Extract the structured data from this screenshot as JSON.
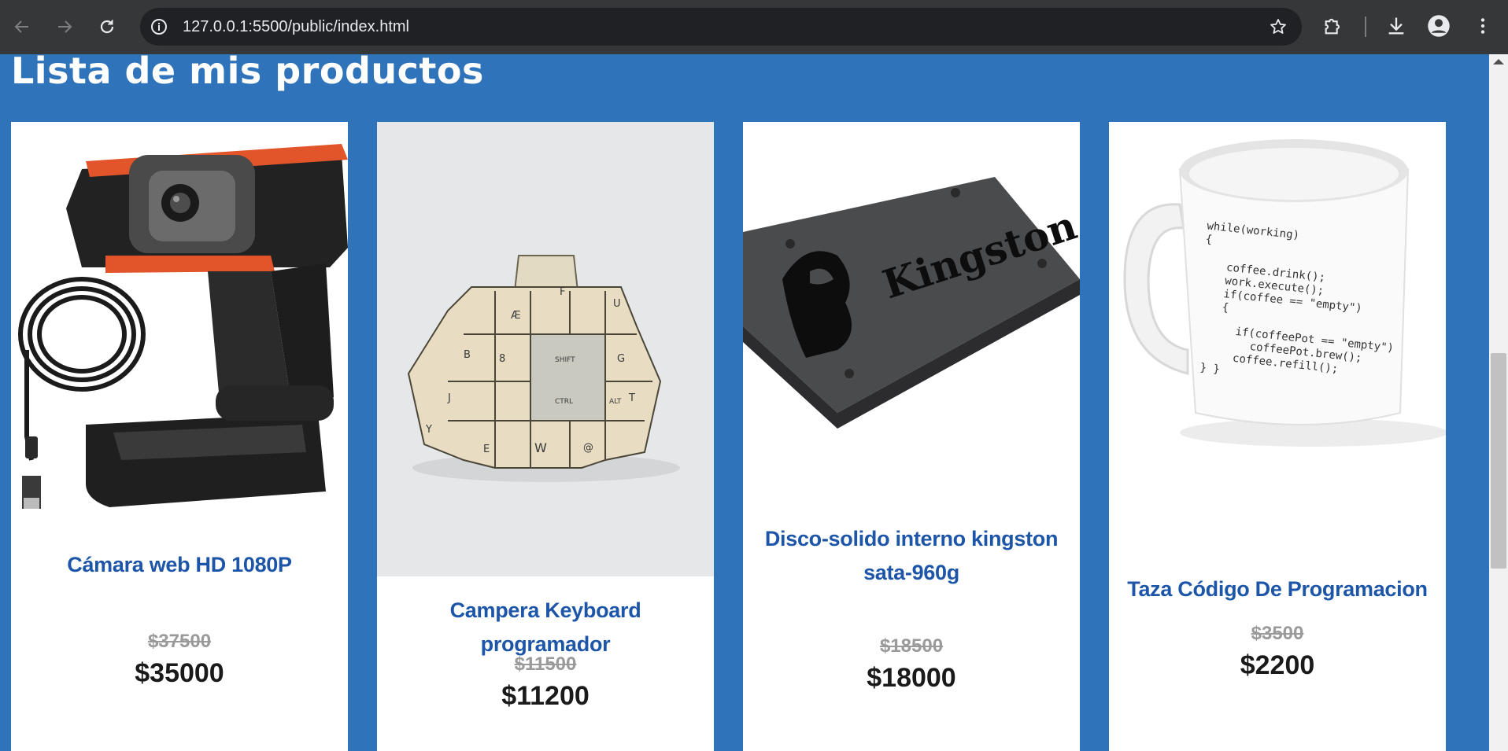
{
  "browser": {
    "url": "127.0.0.1:5500/public/index.html",
    "icons": [
      "back-arrow-icon",
      "forward-arrow-icon",
      "reload-icon",
      "site-info-icon",
      "bookmark-star-icon",
      "extensions-puzzle-icon",
      "download-icon",
      "profile-icon",
      "menu-kebab-icon"
    ]
  },
  "page": {
    "title": "Lista de mis productos"
  },
  "products": [
    {
      "name": "Cámara web HD 1080P",
      "old_price": "$37500",
      "price": "$35000",
      "image": "webcam"
    },
    {
      "name": "Campera Keyboard programador",
      "old_price": "$11500",
      "price": "$11200",
      "image": "keyboard-jacket"
    },
    {
      "name": "Disco-solido interno kingston sata-960g",
      "old_price": "$18500",
      "price": "$18000",
      "image": "kingston-ssd",
      "brand": "Kingston"
    },
    {
      "name": "Taza Código De Programacion",
      "old_price": "$3500",
      "price": "$2200",
      "image": "coffee-mug",
      "mug_code": [
        "while(working)",
        "{",
        "coffee.drink();",
        "work.execute();",
        "if(coffee == \"empty\")",
        "{",
        "if(coffeePot == \"empty\")",
        "coffeePot.brew();",
        "coffee.refill();",
        "}  }"
      ]
    }
  ],
  "jacket_keys": [
    "Æ",
    "F",
    "U",
    "B",
    "8",
    "SHIFT",
    "G",
    "J",
    "CTRL",
    "ALT",
    "T",
    "Y",
    "E",
    "W",
    "@"
  ],
  "colors": {
    "page_bg": "#2f73bb",
    "card_bg": "#ffffff",
    "name": "#1d56a8",
    "old_price": "#9a9a9a",
    "price": "#1a1a1a"
  }
}
